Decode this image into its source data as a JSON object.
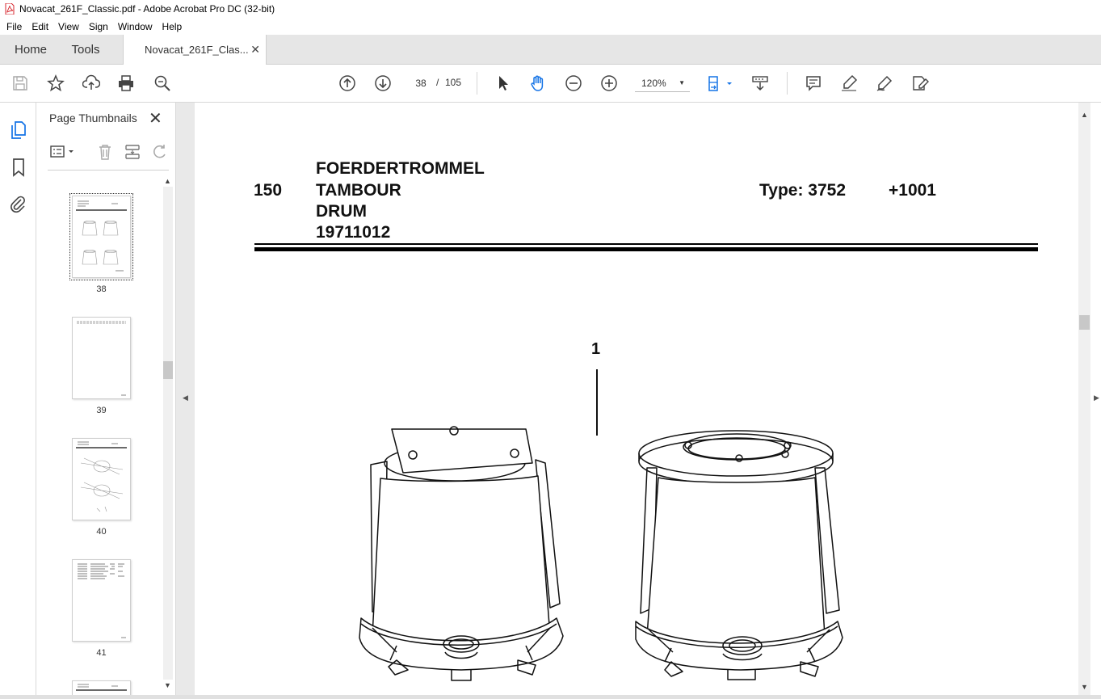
{
  "window": {
    "title": "Novacat_261F_Classic.pdf - Adobe Acrobat Pro DC (32-bit)"
  },
  "menu": [
    "File",
    "Edit",
    "View",
    "Sign",
    "Window",
    "Help"
  ],
  "tabs": {
    "home": "Home",
    "tools": "Tools",
    "document": "Novacat_261F_Clas..."
  },
  "toolbar": {
    "current_page": "38",
    "separator": "/",
    "total_pages": "105",
    "zoom": "120%"
  },
  "panel": {
    "title": "Page Thumbnails",
    "thumbnails": [
      {
        "label": "38"
      },
      {
        "label": "39"
      },
      {
        "label": "40"
      },
      {
        "label": "41"
      }
    ]
  },
  "document": {
    "section_number": "150",
    "title_lines": [
      "FOERDERTROMMEL",
      "TAMBOUR",
      "DRUM",
      "19711012"
    ],
    "type": "Type: 3752",
    "revision": "+1001",
    "item_label": "1"
  },
  "colors": {
    "accent_blue": "#1473e6",
    "pdf_red": "#d7262d",
    "tab_bar": "#e6e6e6"
  }
}
